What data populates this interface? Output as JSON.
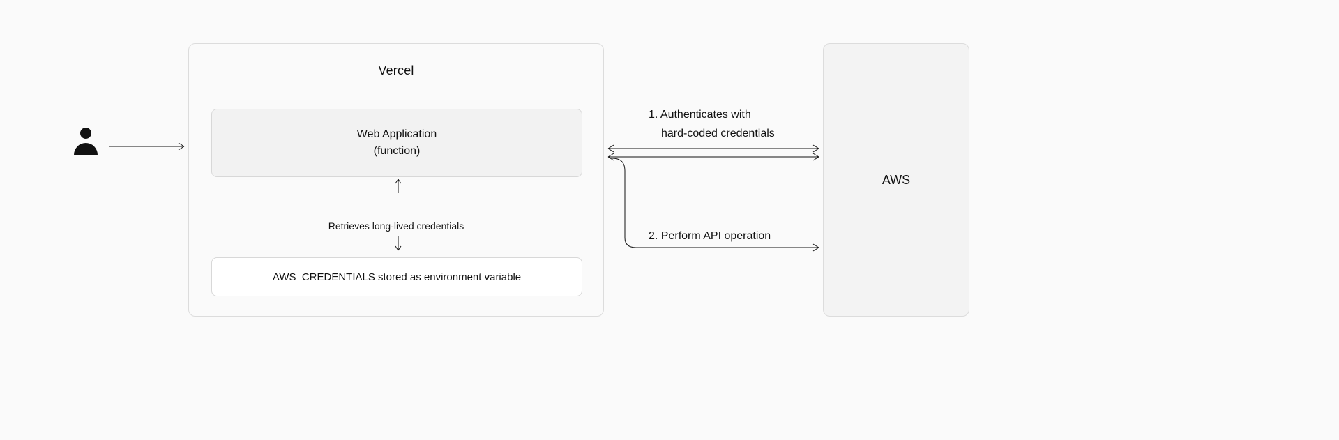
{
  "vercel": {
    "title": "Vercel",
    "webapp_line1": "Web Application",
    "webapp_line2": "(function)",
    "retrieve_label": "Retrieves long-lived credentials",
    "creds_label": "AWS_CREDENTIALS stored as environment variable"
  },
  "aws": {
    "title": "AWS"
  },
  "labels": {
    "auth_line1": "1. Authenticates with",
    "auth_line2": "hard-coded credentials",
    "api": "2. Perform API operation"
  },
  "icons": {
    "user": "user-icon",
    "arrow_right": "arrow-right-icon",
    "arrow_bi": "arrow-bidirectional-icon",
    "arrow_up": "arrow-up-icon",
    "arrow_down": "arrow-down-icon"
  }
}
